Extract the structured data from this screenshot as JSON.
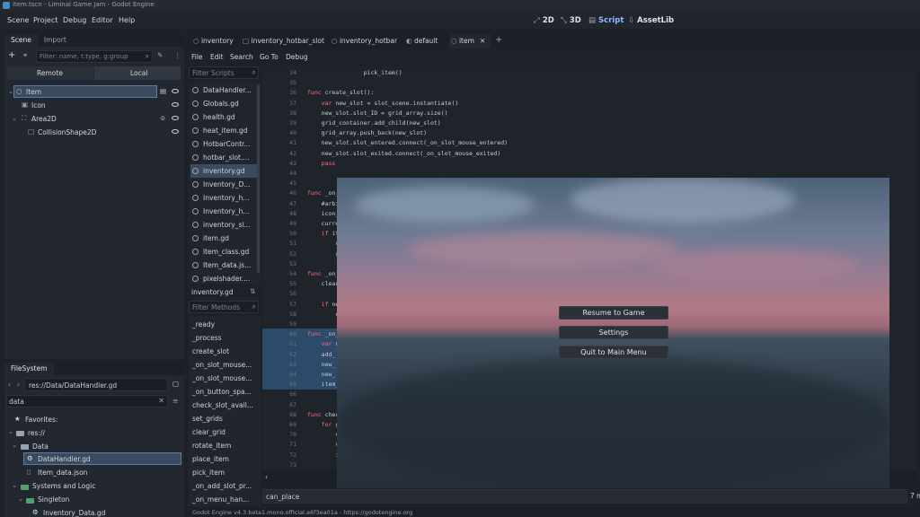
{
  "window_title": "item.tscn - Liminal Game Jam - Godot Engine",
  "menu": [
    "Scene",
    "Project",
    "Debug",
    "Editor",
    "Help"
  ],
  "main_modes": [
    {
      "icon": "2d-icon",
      "label": "2D"
    },
    {
      "icon": "3d-icon",
      "label": "3D"
    },
    {
      "icon": "script-icon",
      "label": "Script"
    },
    {
      "icon": "assetlib-icon",
      "label": "AssetLib"
    }
  ],
  "scene_dock": {
    "tabs": [
      "Scene",
      "Import"
    ],
    "filter_placeholder": "Filter: name, t:type, g:group",
    "remote_label": "Remote",
    "local_label": "Local",
    "tree": [
      {
        "label": "Item",
        "icon": "node-circle-icon"
      },
      {
        "label": "Icon",
        "icon": "sprite-icon"
      },
      {
        "label": "Area2D",
        "icon": "area2d-icon"
      },
      {
        "label": "CollisionShape2D",
        "icon": "collision-shape-icon"
      }
    ]
  },
  "filesystem": {
    "tab": "FileSystem",
    "path": "res://Data/DataHandler.gd",
    "search_value": "data",
    "favorites": "Favorites:",
    "items": [
      "res://",
      "Data",
      "DataHandler.gd",
      "Item_data.json",
      "Systems and Logic",
      "Singleton",
      "Inventory_Data.gd"
    ]
  },
  "editor_tabs": [
    "inventory",
    "inventory_hotbar_slot",
    "inventory_hotbar",
    "default",
    "item"
  ],
  "script_menu": [
    "File",
    "Edit",
    "Search",
    "Go To",
    "Debug"
  ],
  "filter_scripts_placeholder": "Filter Scripts",
  "scripts": [
    "DataHandler...",
    "Globals.gd",
    "health.gd",
    "heat_item.gd",
    "HotbarContr...",
    "hotbar_slot....",
    "inventory.gd",
    "Inventory_D...",
    "Inventory_h...",
    "Inventory_h...",
    "inventory_sl...",
    "item.gd",
    "item_class.gd",
    "Item_data.js...",
    "pixelshader...."
  ],
  "current_script": "inventory.gd",
  "filter_methods_placeholder": "Filter Methods",
  "methods": [
    "_ready",
    "_process",
    "create_slot",
    "_on_slot_mouse...",
    "_on_slot_mouse...",
    "_on_button_spa...",
    "check_slot_avail...",
    "set_grids",
    "clear_grid",
    "rotate_item",
    "place_item",
    "pick_item",
    "_on_add_slot_pr...",
    "_on_menu_han..."
  ],
  "code_lines": [
    {
      "n": "34",
      "t": "                pick_item()"
    },
    {
      "n": "35",
      "t": ""
    },
    {
      "n": "36",
      "t": "func create_slot():"
    },
    {
      "n": "37",
      "t": "    var new_slot = slot_scene.instantiate()"
    },
    {
      "n": "38",
      "t": "    new_slot.slot_ID = grid_array.size()"
    },
    {
      "n": "39",
      "t": "    grid_container.add_child(new_slot)"
    },
    {
      "n": "40",
      "t": "    grid_array.push_back(new_slot)"
    },
    {
      "n": "41",
      "t": "    new_slot.slot_entered.connect(_on_slot_mouse_entered)"
    },
    {
      "n": "42",
      "t": "    new_slot.slot_exited.connect(_on_slot_mouse_exited)"
    },
    {
      "n": "43",
      "t": "    pass"
    },
    {
      "n": "44",
      "t": ""
    },
    {
      "n": "45",
      "t": ""
    },
    {
      "n": "46",
      "t": "func _on_"
    },
    {
      "n": "47",
      "t": "    #arbi"
    },
    {
      "n": "48",
      "t": "    icon_"
    },
    {
      "n": "49",
      "t": "    curre"
    },
    {
      "n": "50",
      "t": "    if it"
    },
    {
      "n": "51",
      "t": "        c"
    },
    {
      "n": "52",
      "t": "        s"
    },
    {
      "n": "53",
      "t": ""
    },
    {
      "n": "54",
      "t": "func _on_"
    },
    {
      "n": "55",
      "t": "    clear"
    },
    {
      "n": "56",
      "t": ""
    },
    {
      "n": "57",
      "t": "    if ne"
    },
    {
      "n": "58",
      "t": "        c"
    },
    {
      "n": "59",
      "t": ""
    },
    {
      "n": "60",
      "t": "func _on_"
    },
    {
      "n": "61",
      "t": "    var n"
    },
    {
      "n": "62",
      "t": "    add_"
    },
    {
      "n": "63",
      "t": "    new_"
    },
    {
      "n": "64",
      "t": "    new_"
    },
    {
      "n": "65",
      "t": "    item_"
    },
    {
      "n": "66",
      "t": ""
    },
    {
      "n": "67",
      "t": ""
    },
    {
      "n": "68",
      "t": "func chec"
    },
    {
      "n": "69",
      "t": "    for g"
    },
    {
      "n": "70",
      "t": "        v"
    },
    {
      "n": "71",
      "t": "        v"
    },
    {
      "n": "72",
      "t": "        i"
    },
    {
      "n": "73",
      "t": ""
    }
  ],
  "search_field_value": "can_place",
  "search_trailing": "7 m",
  "pause_menu": {
    "resume": "Resume to Game",
    "settings": "Settings",
    "quit": "Quit to Main Menu"
  },
  "status_text": "Godot Engine v4.3.beta1.mono.official.a6f3ea01a - https://godotengine.org",
  "accent": "#478cbf"
}
